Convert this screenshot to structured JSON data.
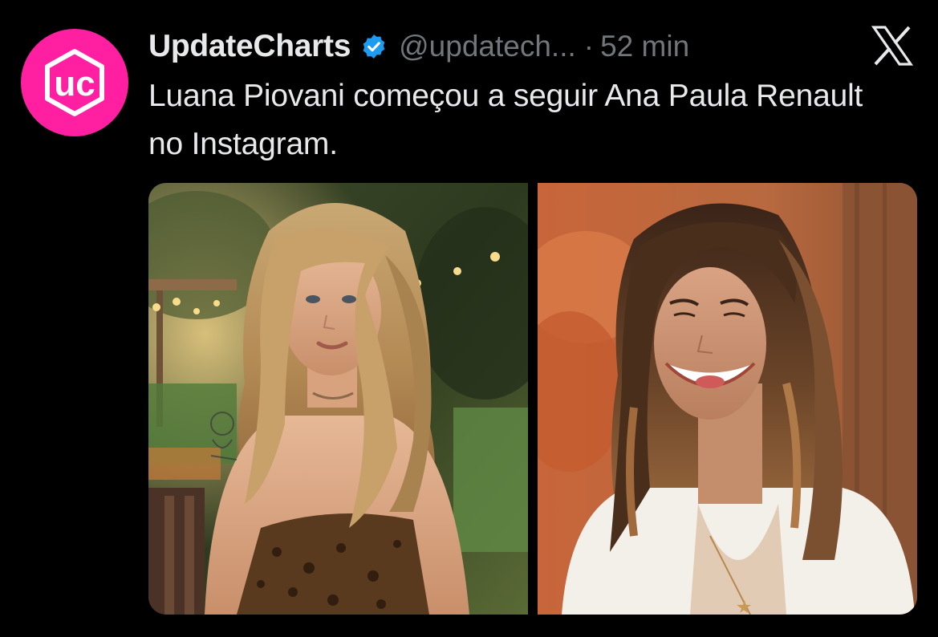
{
  "author": {
    "display_name": "UpdateCharts",
    "handle": "@updatech...",
    "separator": "·",
    "time": "52 min",
    "avatar_icon": "updatecharts-logo-icon",
    "avatar_letters": "uc",
    "verified_icon": "verified-badge-icon"
  },
  "tweet": {
    "text": "Luana Piovani começou a seguir Ana Paula Renault no Instagram."
  },
  "platform": {
    "logo_icon": "x-logo-icon"
  },
  "media": {
    "photos": [
      {
        "icon": "photo-luana-piovani"
      },
      {
        "icon": "photo-ana-paula-renault"
      }
    ]
  },
  "colors": {
    "background": "#000000",
    "text_primary": "#e7e9ea",
    "text_secondary": "#71767b",
    "verified": "#1d9bf0",
    "avatar_brand": "#ff1fa0"
  }
}
